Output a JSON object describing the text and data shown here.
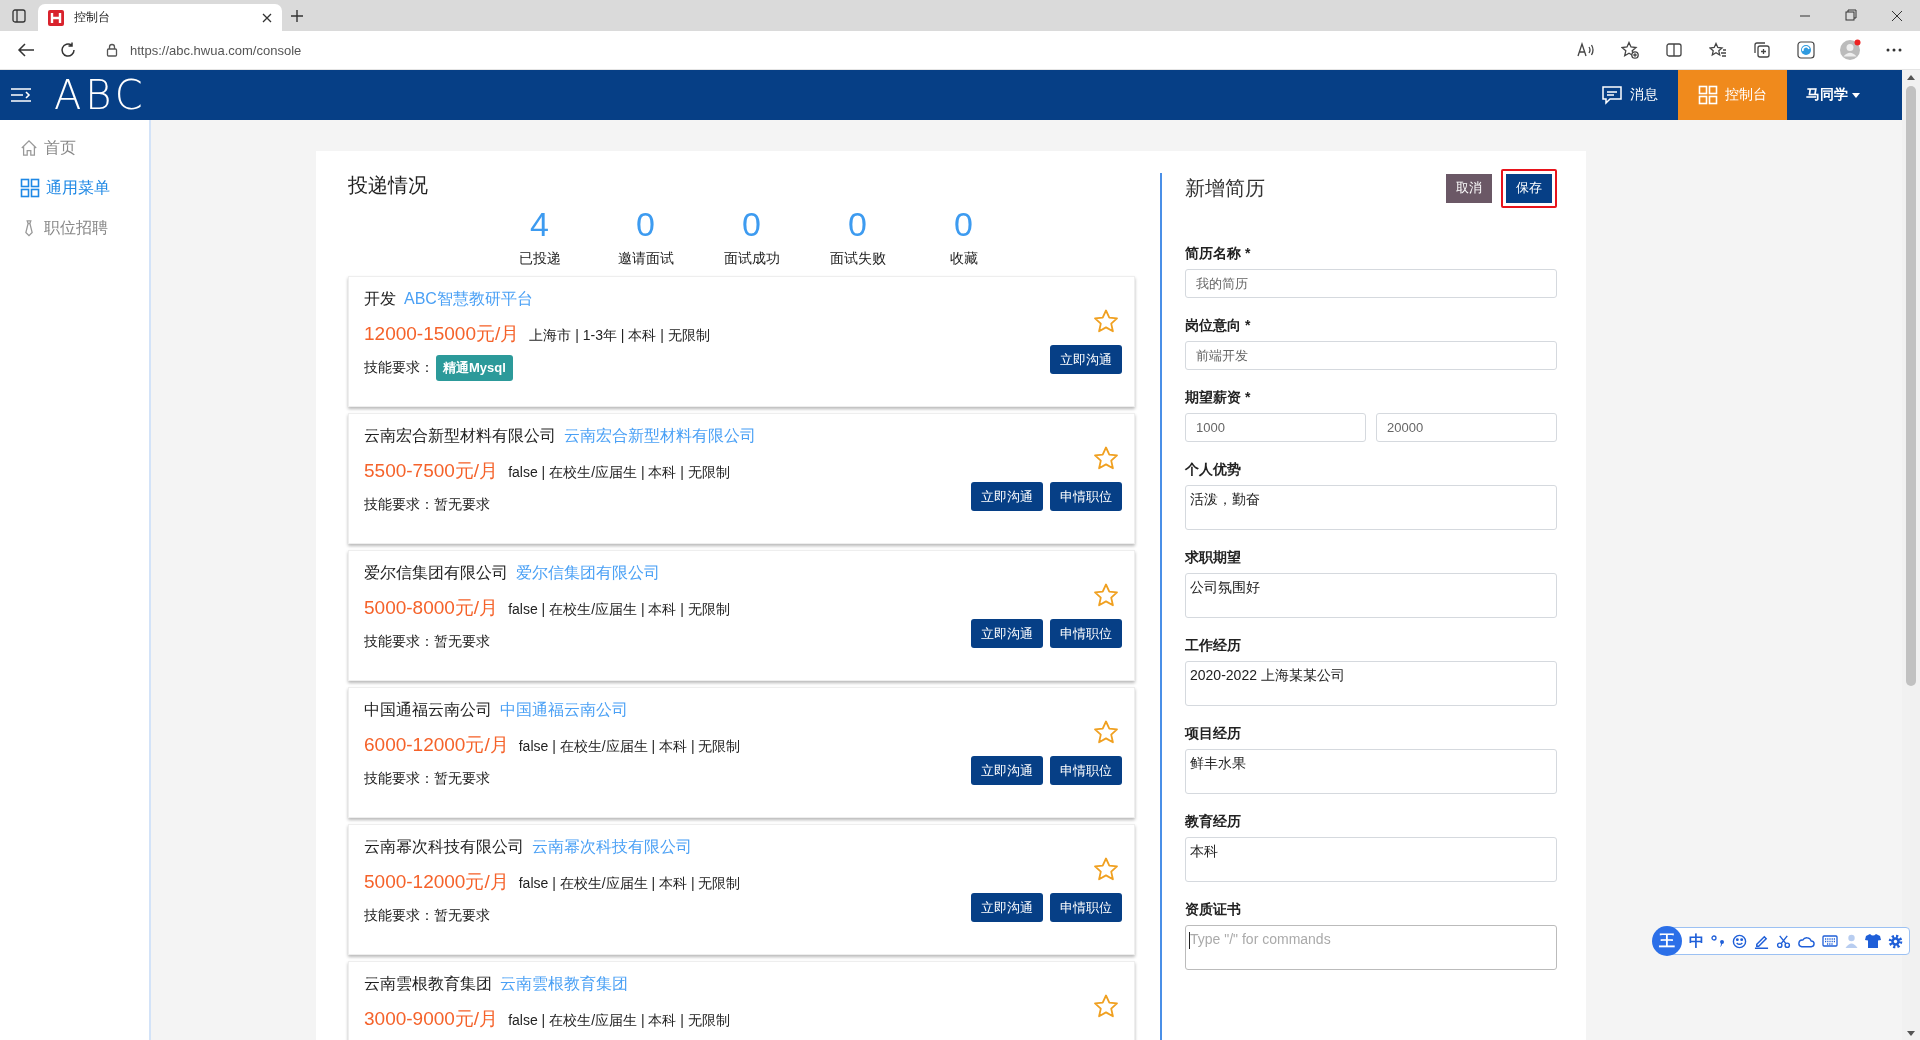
{
  "browser": {
    "tab_title": "控制台",
    "url": "https://abc.hwua.com/console"
  },
  "header": {
    "logo": "ABC",
    "nav": [
      {
        "label": "消息",
        "selected": false
      },
      {
        "label": "控制台",
        "selected": true
      }
    ],
    "user": "马同学"
  },
  "sidebar": {
    "items": [
      {
        "label": "首页",
        "selected": false
      },
      {
        "label": "通用菜单",
        "selected": true
      },
      {
        "label": "职位招聘",
        "selected": false
      }
    ]
  },
  "delivery": {
    "title": "投递情况",
    "stats": [
      {
        "value": "4",
        "label": "已投递"
      },
      {
        "value": "0",
        "label": "邀请面试"
      },
      {
        "value": "0",
        "label": "面试成功"
      },
      {
        "value": "0",
        "label": "面试失败"
      },
      {
        "value": "0",
        "label": "收藏"
      }
    ],
    "jobs": [
      {
        "title": "开发",
        "company": "ABC智慧教研平台",
        "salary": "12000-15000元/月",
        "info": "上海市 | 1-3年 | 本科 | 无限制",
        "skills": {
          "kind": "tag",
          "label": "技能要求：",
          "tag": "精通Mysql"
        },
        "buttons": [
          "立即沟通"
        ]
      },
      {
        "title": "云南宏合新型材料有限公司",
        "company": "云南宏合新型材料有限公司",
        "salary": "5500-7500元/月",
        "info": "false | 在校生/应届生 | 本科 | 无限制",
        "skills": {
          "kind": "text",
          "text": "技能要求：暂无要求"
        },
        "buttons": [
          "立即沟通",
          "申情职位"
        ]
      },
      {
        "title": "爱尔信集团有限公司",
        "company": "爱尔信集团有限公司",
        "salary": "5000-8000元/月",
        "info": "false | 在校生/应届生 | 本科 | 无限制",
        "skills": {
          "kind": "text",
          "text": "技能要求：暂无要求"
        },
        "buttons": [
          "立即沟通",
          "申情职位"
        ]
      },
      {
        "title": "中国通福云南公司",
        "company": "中国通福云南公司",
        "salary": "6000-12000元/月",
        "info": "false | 在校生/应届生 | 本科 | 无限制",
        "skills": {
          "kind": "text",
          "text": "技能要求：暂无要求"
        },
        "buttons": [
          "立即沟通",
          "申情职位"
        ]
      },
      {
        "title": "云南幂次科技有限公司",
        "company": "云南幂次科技有限公司",
        "salary": "5000-12000元/月",
        "info": "false | 在校生/应届生 | 本科 | 无限制",
        "skills": {
          "kind": "text",
          "text": "技能要求：暂无要求"
        },
        "buttons": [
          "立即沟通",
          "申情职位"
        ]
      },
      {
        "title": "云南雲根教育集团",
        "company": "云南雲根教育集团",
        "salary": "3000-9000元/月",
        "info": "false | 在校生/应届生 | 本科 | 无限制"
      }
    ]
  },
  "resume_form": {
    "title": "新增简历",
    "buttons": [
      {
        "label": "取消",
        "kind": "cancel",
        "highlighted": false
      },
      {
        "label": "保存",
        "kind": "save",
        "highlighted": true
      }
    ],
    "fields": [
      {
        "label": "简历名称 *",
        "kind": "input",
        "inputs": [
          {
            "placeholder": "我的简历"
          }
        ]
      },
      {
        "label": "岗位意向 *",
        "kind": "input",
        "inputs": [
          {
            "placeholder": "前端开发"
          }
        ]
      },
      {
        "label": "期望薪资 *",
        "kind": "input",
        "inputs": [
          {
            "placeholder": "1000"
          },
          {
            "placeholder": "20000"
          }
        ]
      },
      {
        "label": "个人优势",
        "kind": "textarea",
        "value": "活泼，勤奋"
      },
      {
        "label": "求职期望",
        "kind": "textarea",
        "value": "公司氛围好"
      },
      {
        "label": "工作经历",
        "kind": "textarea",
        "value": "2020-2022 上海某某公司"
      },
      {
        "label": "项目经历",
        "kind": "textarea",
        "value": "鲜丰水果"
      },
      {
        "label": "教育经历",
        "kind": "textarea",
        "value": "本科"
      },
      {
        "label": "资质证书",
        "kind": "textarea",
        "placeholder": "Type \"/\" for commands",
        "focused": true
      }
    ]
  },
  "ime_toolbar": {
    "logo": "王",
    "mode": "中"
  }
}
